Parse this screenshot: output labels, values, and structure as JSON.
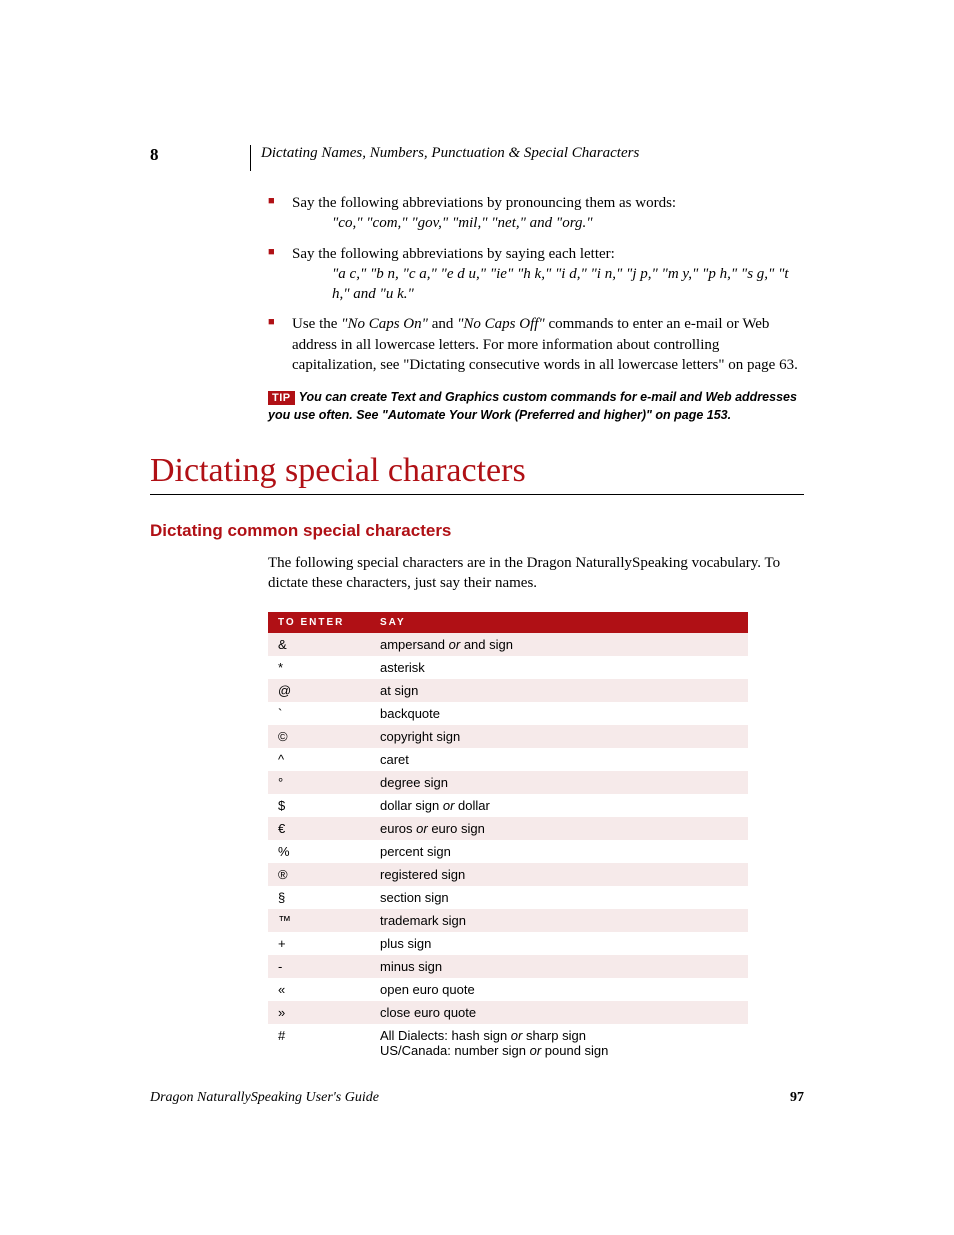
{
  "header": {
    "chapter": "8",
    "running": "Dictating Names, Numbers, Punctuation & Special Characters"
  },
  "bullets": [
    {
      "lead": "Say the following abbreviations by pronouncing them as words:",
      "quote": "\"co,\" \"com,\" \"gov,\" \"mil,\" \"net,\" and \"org.\""
    },
    {
      "lead": "Say the following abbreviations by saying each letter:",
      "quote": "\"a c,\" \"b n, \"c a,\" \"e d u,\" \"ie\" \"h k,\" \"i d,\" \"i n,\" \"j p,\" \"m y,\" \"p h,\" \"s g,\" \"t h,\" and \"u k.\""
    },
    {
      "html": "Use the <i>\"No Caps On\"</i> and <i>\"No Caps Off\"</i> commands to enter an e-mail or Web address in all lowercase letters. For more information about controlling capitalization, see \"Dictating consecutive words in all lowercase letters\" on page 63."
    }
  ],
  "tip": {
    "badge": "TIP",
    "text": "You can create Text and Graphics custom commands for e-mail and Web addresses you use often. See \"Automate Your Work (Preferred and higher)\" on page 153."
  },
  "h1": "Dictating special characters",
  "h2": "Dictating common special characters",
  "intro": "The following special characters are in the Dragon NaturallySpeaking vocabulary. To dictate these characters, just say their names.",
  "table": {
    "headers": [
      "To Enter",
      "Say"
    ],
    "rows": [
      {
        "sym": "&",
        "say": "ampersand <span class='or'>or</span> and sign"
      },
      {
        "sym": "*",
        "say": "asterisk"
      },
      {
        "sym": "@",
        "say": "at sign"
      },
      {
        "sym": "`",
        "say": "backquote"
      },
      {
        "sym": "©",
        "say": "copyright sign"
      },
      {
        "sym": "^",
        "say": "caret"
      },
      {
        "sym": "°",
        "say": "degree sign"
      },
      {
        "sym": "$",
        "say": "dollar sign <span class='or'>or</span> dollar"
      },
      {
        "sym": "€",
        "say": "euros <span class='or'>or</span> euro sign"
      },
      {
        "sym": "%",
        "say": "percent sign"
      },
      {
        "sym": "®",
        "say": "registered sign"
      },
      {
        "sym": "§",
        "say": "section sign"
      },
      {
        "sym": "™",
        "say": "trademark sign"
      },
      {
        "sym": "+",
        "say": "plus sign"
      },
      {
        "sym": "-",
        "say": "minus sign"
      },
      {
        "sym": "«",
        "say": "open euro quote"
      },
      {
        "sym": "»",
        "say": "close euro quote"
      },
      {
        "sym": "#",
        "say": "All Dialects: hash sign <span class='or'>or</span> sharp sign<br>US/Canada: number sign <span class='or'>or</span> pound sign"
      }
    ]
  },
  "footer": {
    "left": "Dragon NaturallySpeaking User's Guide",
    "right": "97"
  }
}
